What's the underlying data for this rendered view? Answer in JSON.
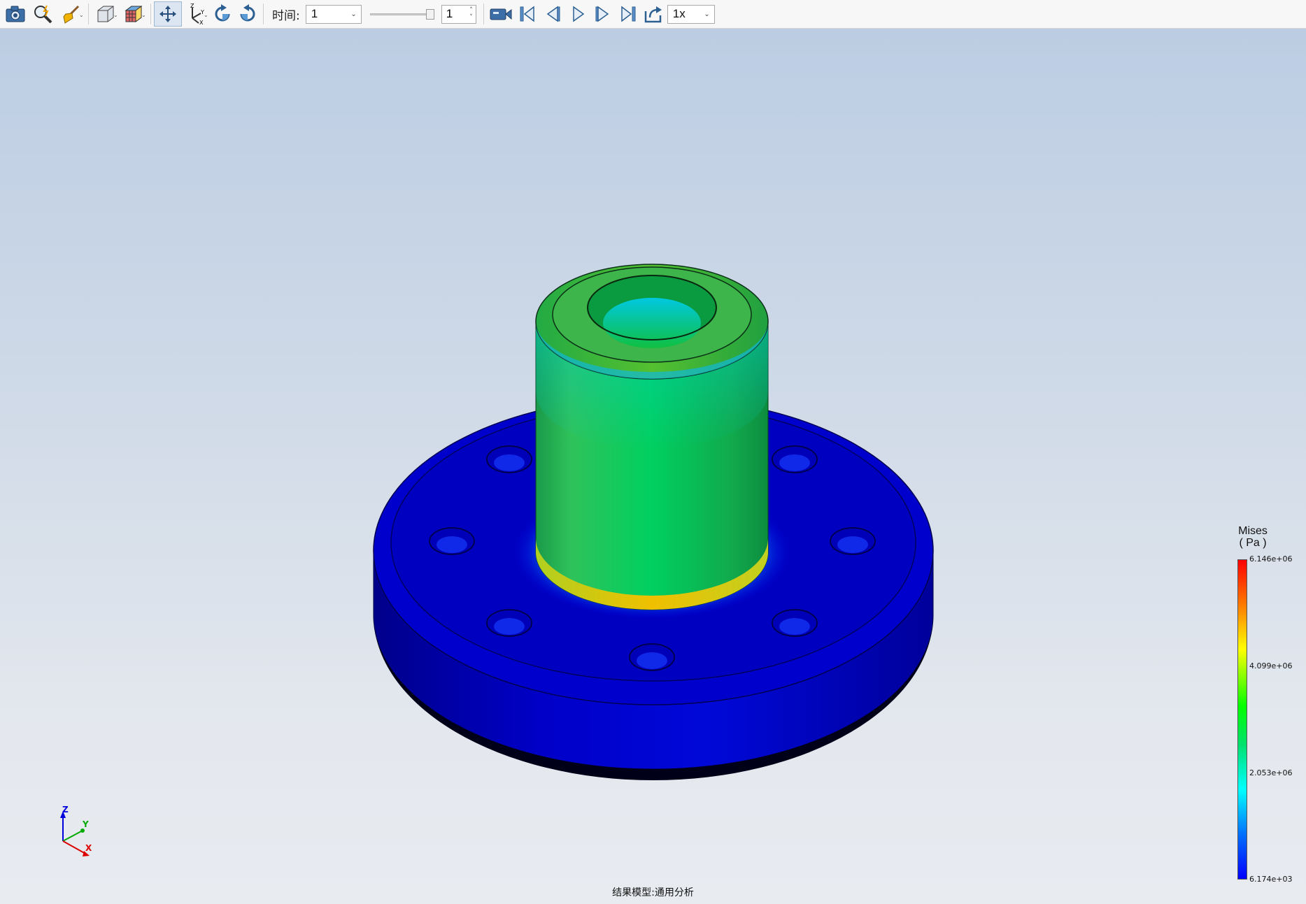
{
  "toolbar": {
    "icons": [
      "camera-icon",
      "zoom-icon",
      "brush-icon",
      "view-cube-icon",
      "color-cube-icon",
      "pan-icon",
      "axes-icon",
      "rotate-cw-icon",
      "rotate-ccw-icon",
      "record-icon",
      "first-frame-icon",
      "prev-frame-icon",
      "play-icon",
      "next-frame-icon",
      "last-frame-icon",
      "export-icon"
    ],
    "time_label": "时间:",
    "time_value": "1",
    "frame_value": "1",
    "speed_value": "1x"
  },
  "viewport": {
    "background_top": "#bccde3",
    "background_bottom": "#e8ebf0"
  },
  "axes_triad": {
    "z": "Z",
    "y": "Y",
    "x": "X"
  },
  "legend": {
    "title": "Mises",
    "unit": "( Pa )",
    "ticks": [
      "6.146e+06",
      "4.099e+06",
      "2.053e+06",
      "6.174e+03"
    ]
  },
  "footer": {
    "label": "结果模型:通用分析"
  }
}
